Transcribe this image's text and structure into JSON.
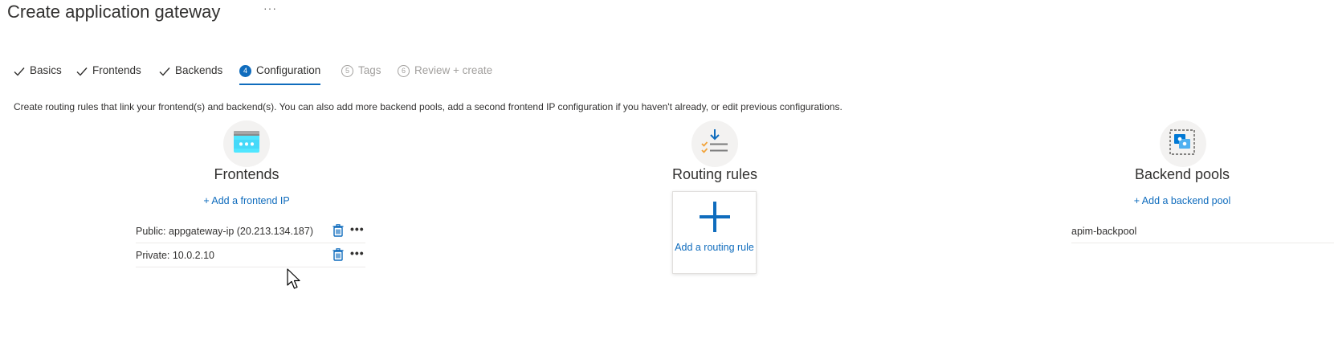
{
  "header": {
    "title": "Create application gateway",
    "more": "···"
  },
  "tabs": [
    {
      "label": "Basics",
      "state": "completed"
    },
    {
      "label": "Frontends",
      "state": "completed"
    },
    {
      "label": "Backends",
      "state": "completed"
    },
    {
      "label": "Configuration",
      "state": "active",
      "step": "4"
    },
    {
      "label": "Tags",
      "state": "disabled",
      "step": "5"
    },
    {
      "label": "Review + create",
      "state": "disabled",
      "step": "6"
    }
  ],
  "description": "Create routing rules that link your frontend(s) and backend(s). You can also add more backend pools, add a second frontend IP configuration if you haven't already, or edit previous configurations.",
  "frontends": {
    "icon": "frontend-browser-icon",
    "heading": "Frontends",
    "add_link": "+ Add a frontend IP",
    "items": [
      {
        "label": "Public: appgateway-ip (20.213.134.187)"
      },
      {
        "label": "Private: 10.0.2.10"
      }
    ]
  },
  "routing": {
    "icon": "routing-rules-icon",
    "heading": "Routing rules",
    "add_card_label": "Add a routing rule"
  },
  "backends": {
    "icon": "backend-pool-icon",
    "heading": "Backend pools",
    "add_link": "+ Add a backend pool",
    "items": [
      {
        "label": "apim-backpool"
      }
    ]
  },
  "colors": {
    "accent": "#0f6cbd",
    "text": "#323130",
    "disabled": "#a19f9d"
  }
}
